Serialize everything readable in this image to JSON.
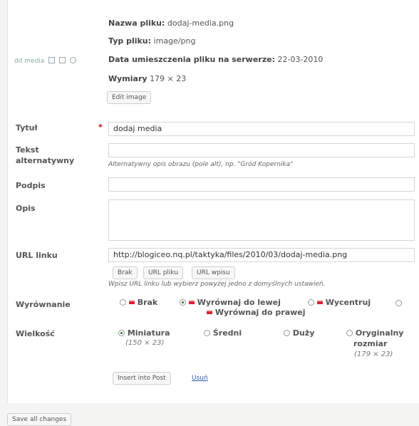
{
  "thumb": {
    "label": "dd media"
  },
  "file_info": {
    "name_label": "Nazwa pliku:",
    "name_value": "dodaj-media.png",
    "type_label": "Typ pliku:",
    "type_value": "image/png",
    "date_label": "Data umieszczenia pliku na serwerze:",
    "date_value": "22-03-2010",
    "dims_label": "Wymiary",
    "dims_value": "179 × 23",
    "edit_image": "Edit image"
  },
  "fields": {
    "title_label": "Tytuł",
    "required_mark": "*",
    "title_value": "dodaj media",
    "alt_label_1": "Tekst",
    "alt_label_2": "alternatywny",
    "alt_value": "",
    "alt_hint": "Alternatywny opis obrazu (pole alt), np. \"Gród Kopernika\"",
    "caption_label": "Podpis",
    "caption_value": "",
    "desc_label": "Opis",
    "desc_value": "",
    "url_label": "URL linku",
    "url_value": "http://blogiceo.nq.pl/taktyka/files/2010/03/dodaj-media.png",
    "url_btn_none": "Brak",
    "url_btn_file": "URL pliku",
    "url_btn_post": "URL wpisu",
    "url_hint": "Wpisz URL linku lub wybierz powyżej jedno z domyślnych ustawień."
  },
  "alignment": {
    "label": "Wyrównanie",
    "opt_none": "Brak",
    "opt_left": "Wyrównaj do lewej",
    "opt_center": "Wycentruj",
    "opt_right": "Wyrównaj do prawej",
    "selected": "Wyrównaj do lewej"
  },
  "size": {
    "label": "Wielkość",
    "opt_thumb": "Miniatura",
    "opt_thumb_dims": "(150 × 23)",
    "opt_medium": "Średni",
    "opt_large": "Duży",
    "opt_full_1": "Oryginalny",
    "opt_full_2": "rozmiar",
    "opt_full_dims": "(179 × 23)",
    "selected": "Miniatura"
  },
  "actions": {
    "insert": "Insert into Post",
    "delete": "Usuń",
    "save_all": "Save all changes"
  }
}
